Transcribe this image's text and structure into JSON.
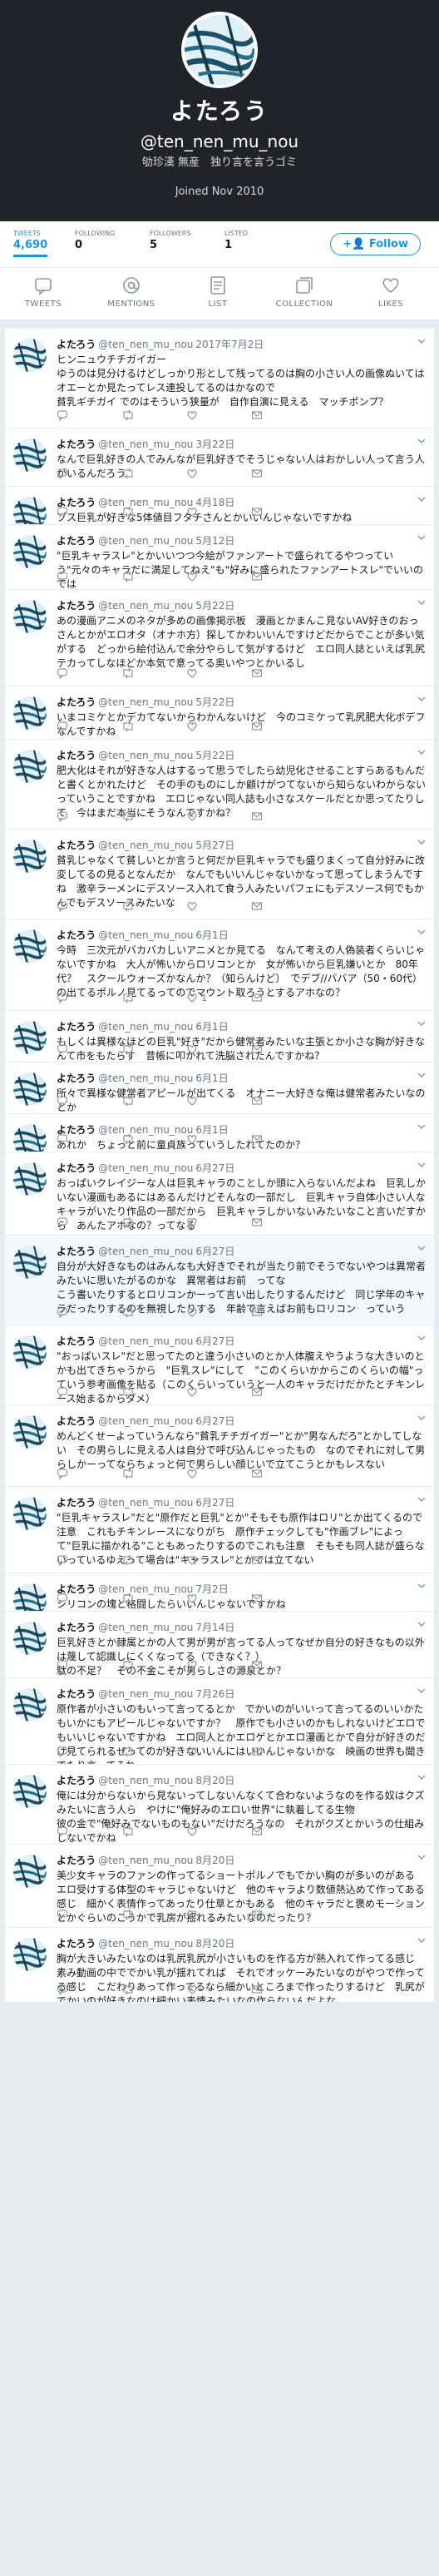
{
  "profile": {
    "display_name": "よたろう",
    "handle": "@ten_nen_mu_nou",
    "bio": "劬珍漢 無産　独り言を言うゴミ",
    "joined": "Joined Nov 2010"
  },
  "stats": {
    "tweets_label": "TWEETS",
    "tweets_value": "4,690",
    "following_label": "FOLLOWING",
    "following_value": "0",
    "followers_label": "FOLLOWERS",
    "followers_value": "5",
    "listed_label": "LISTED",
    "listed_value": "1",
    "follow_label": "Follow"
  },
  "tabs": [
    {
      "label": "TWEETS",
      "icon": "tweet-icon"
    },
    {
      "label": "MENTIONS",
      "icon": "at-icon"
    },
    {
      "label": "LIST",
      "icon": "list-icon"
    },
    {
      "label": "COLLECTION",
      "icon": "collection-icon"
    },
    {
      "label": "LIKES",
      "icon": "heart-icon"
    }
  ],
  "colors": {
    "header_bg": "#20232a",
    "accent": "#1b95e0",
    "timeline_bg": "#e6ecf0"
  },
  "tweets": [
    {
      "name": "よたろう",
      "user": "@ten_nen_mu_nou",
      "date": "2017年7月2日",
      "text": "ヒンニュウチチガイガー\nゆうのは見分けるけどしっかり形として残ってるのは胸の小さい人の画像ぬいてはオエーとか見たってレス連投してるのはかなので\n貧乳ギチガイ でのはそういう狭量が　自作自演に見える　マッチポンプ？"
    },
    {
      "name": "よたろう",
      "user": "@ten_nen_mu_nou",
      "date": "3月22日",
      "text": "なんで巨乳好きの人でみんなが巨乳好きでそうじゃない人はおかしい人って言う人がいるんだろう"
    },
    {
      "name": "よたろう",
      "user": "@ten_nen_mu_nou",
      "date": "4月18日",
      "text": "ブス巨乳が好きな5体値目フタチさんとかいいんじゃないですかね"
    },
    {
      "name": "よたろう",
      "user": "@ten_nen_mu_nou",
      "date": "5月12日",
      "text": "\"巨乳キャラスレ\"とかいいつつ今絵がファンアートで盛られてるやつっていう\"元々のキャラだに満足してねえ\"も\"好みに盛られたファンアートスレ\"でいいのでは"
    },
    {
      "name": "よたろう",
      "user": "@ten_nen_mu_nou",
      "date": "5月22日",
      "text": "あの漫画アニメのネタが多めの画像掲示板　漫画とかまんこ見ないAV好きのおっさんとかがエロオタ（オナホ方）探してかわいいんですけどだからでことが多い気がする　どっから絵付込んで余分やらして気がするけど　エロ同人誌といえば乳尻テカってしなほどか本気で意ってる奥いやつとかいるし"
    },
    {
      "name": "よたろう",
      "user": "@ten_nen_mu_nou",
      "date": "5月22日",
      "text": "いまコミケとかデカてないからわかんないけど　今のコミケって乳尻肥大化ボデフなんですかね"
    },
    {
      "name": "よたろう",
      "user": "@ten_nen_mu_nou",
      "date": "5月22日",
      "text": "肥大化はそれが好きな人はするって思うでしたら幼児化させることすらあるもんだ　と書くとかれたけど　その手のものにしか顧けがつてないから知らないわからないっていうことですかね　エロじゃない同人誌も小さなスケールだとか思ってたりして　今はまだ本当にそうなんですかね？"
    },
    {
      "name": "よたろう",
      "user": "@ten_nen_mu_nou",
      "date": "5月27日",
      "text": "貧乳じゃなくて貧しいとか言うと何だか巨乳キャラでも盛りまくって自分好みに改変してるの見るとなんだか　なんでもいいんじゃないかなって思ってしまうんですね　激辛ラーメンにデスソース入れて食う人みたいパフェにもデスソース何でもかんでもデスソースみたいな"
    },
    {
      "name": "よたろう",
      "user": "@ten_nen_mu_nou",
      "date": "6月1日",
      "text": "今時　三次元がバカバカしいアニメとか見てる　なんて考えの人偽装者くらいじゃないですかね　大人が怖いからロリコンとか　女が怖いから巨乳嫌いとか　80年代？　スクールウォーズかなんか？（知らんけど）　でデブ//ババア（50・60代）の出てるポルノ見てるってのでマウント取ろうとするアホなの？",
      "actions": {
        "reply": "",
        "retweet": "",
        "like": "1"
      }
    },
    {
      "name": "よたろう",
      "user": "@ten_nen_mu_nou",
      "date": "6月1日",
      "text": "もしくは異様なほどの巨乳\"好き\"だから健常者みたいな主張とか小さな胸が好きなんて市をもたらす　昔帳に叩かれて洗脳されたんですかね？"
    },
    {
      "name": "よたろう",
      "user": "@ten_nen_mu_nou",
      "date": "6月1日",
      "text": "所々で異様な健常者アピールが出てくる　オナニー大好きな俺は健常者みたいなのとか"
    },
    {
      "name": "よたろう",
      "user": "@ten_nen_mu_nou",
      "date": "6月1日",
      "text": "あれか　ちょっと前に童貞族っていうしたれてたのか？"
    },
    {
      "name": "よたろう",
      "user": "@ten_nen_mu_nou",
      "date": "6月27日",
      "text": "おっぱいクレイジーな人は巨乳キャラのことしか頭に入らないんだよね　巨乳しかいない漫画もあるにはあるんだけどそんなの一部だし　巨乳キャラ自体小さい人なキャラがいたり作品の一部だから　巨乳キャラしかいないみたいなこと言いだすから　あんたアホなの？ってなる"
    },
    {
      "name": "よたろう",
      "user": "@ten_nen_mu_nou",
      "date": "6月27日",
      "text": "自分が大好きなものはみんなも大好きでそれが当たり前でそうでないやつは異常者みたいに思いたがるのかな　異常者はお前　ってな\nこう書いたりするとロリコンかーって言い出したりするんだけど　同じ学年のキャラだったりするのを無視したりする　年齢で言えばお前もロリコン　っていう",
      "highlight": true
    },
    {
      "name": "よたろう",
      "user": "@ten_nen_mu_nou",
      "date": "6月27日",
      "text": "\"おっぱいスレ\"だと思ってたのと違う小さいのとか人体腹えやうような大きいのとかも出てきちゃうから　\"巨乳スレ\"にして　\"このくらいかからこのくらいの幅\"っていう参考画像を貼る（このくらいっていうと一人のキャラだけだかたとチキンレース始まるからダメ）"
    },
    {
      "name": "よたろう",
      "user": "@ten_nen_mu_nou",
      "date": "6月27日",
      "text": "めんどくせーよっていうんなら\"貧乳チチガイガー\"とか\"男なんだろ\"とかしてしない　その男らしに見える人は自分で呼び込んじゃったもの　なのでそれに対して男らしかーってならちょっと何で男らしい顔じいで立てこうとかもレスない"
    },
    {
      "name": "よたろう",
      "user": "@ten_nen_mu_nou",
      "date": "6月27日",
      "text": "\"巨乳キャラスレ\"だと\"原作だと巨乳\"とか\"そもそも原作はロリ\"とか出てくるので注意　これもチキンレースになりがち　原作チェックしても\"作画ブレ\"によって\"巨乳に描かれる\"こともあったりするのでこれも注意　そもそも同人誌が盛らないっているゆえって場合は\"キャラスレ\"とかでは立てない"
    },
    {
      "name": "よたろう",
      "user": "@ten_nen_mu_nou",
      "date": "7月2日",
      "text": "シリコンの塊と格闘したらいいんじゃないですかね"
    },
    {
      "name": "よたろう",
      "user": "@ten_nen_mu_nou",
      "date": "7月14日",
      "text": "巨乳好きとか隷属とかの人て男が男が言ってる人ってなぜか自分の好きなもの以外は蔑して認識しにくくなってる（できなく？）\n駄の不足？　その不金こそが男らしさの源泉とか？"
    },
    {
      "name": "よたろう",
      "user": "@ten_nen_mu_nou",
      "date": "7月26日",
      "text": "原作者が小さいのもいって言ってるとか　でかいのがいいって言ってるのいいかたもいかにもアピールじゃないですか？　原作でも小さいのかもしれないけどエロでもいいじゃないですかね　エロ同人とかエロゲとかエロ漫画とかで自分が好きのだけ見てられるぜってのが好きないいんにはいいんじゃないかな　映画の世界も聞きでたり言ってそれ"
    },
    {
      "name": "よたろう",
      "user": "@ten_nen_mu_nou",
      "date": "8月20日",
      "text": "俺には分からないから見ないってしないんなくて合わないようなのを作る奴はクズみたいに言う人ら　やけに\"俺好みのエロい世界\"に執着してる生物\n彼の金で\"俺好みでないものもない\"だけだろうなの　それがクズとかいうの仕組みしないでかね"
    },
    {
      "name": "よたろう",
      "user": "@ten_nen_mu_nou",
      "date": "8月20日",
      "text": "美少女キャラのファンの作ってるショートポルノでもでかい胸のが多いのがある　エロ受けする体型のキャラじゃないけど　他のキャラより数値熱込めて作ってある感じ　細かく表情作ってあったり仕草とかもある　他のキャラだと褒めモーションとかぐらいのこうかで乳房が揺れるみたいなのだったり？"
    },
    {
      "name": "よたろう",
      "user": "@ten_nen_mu_nou",
      "date": "8月20日",
      "text": "胸が大きいみたいなのは乳尻乳尻が小さいものを作る方が熱入れて作ってる感じ　素み動画の中ででかい乳が揺れてれば　それでオッケーみたいなのがやつで作ってる感じ　こだわりあって作ってるなら細かいところまで作ったりするけど　乳尻がでかいのが好きなのは細かい表情みたいなの作らないんだよな"
    }
  ]
}
